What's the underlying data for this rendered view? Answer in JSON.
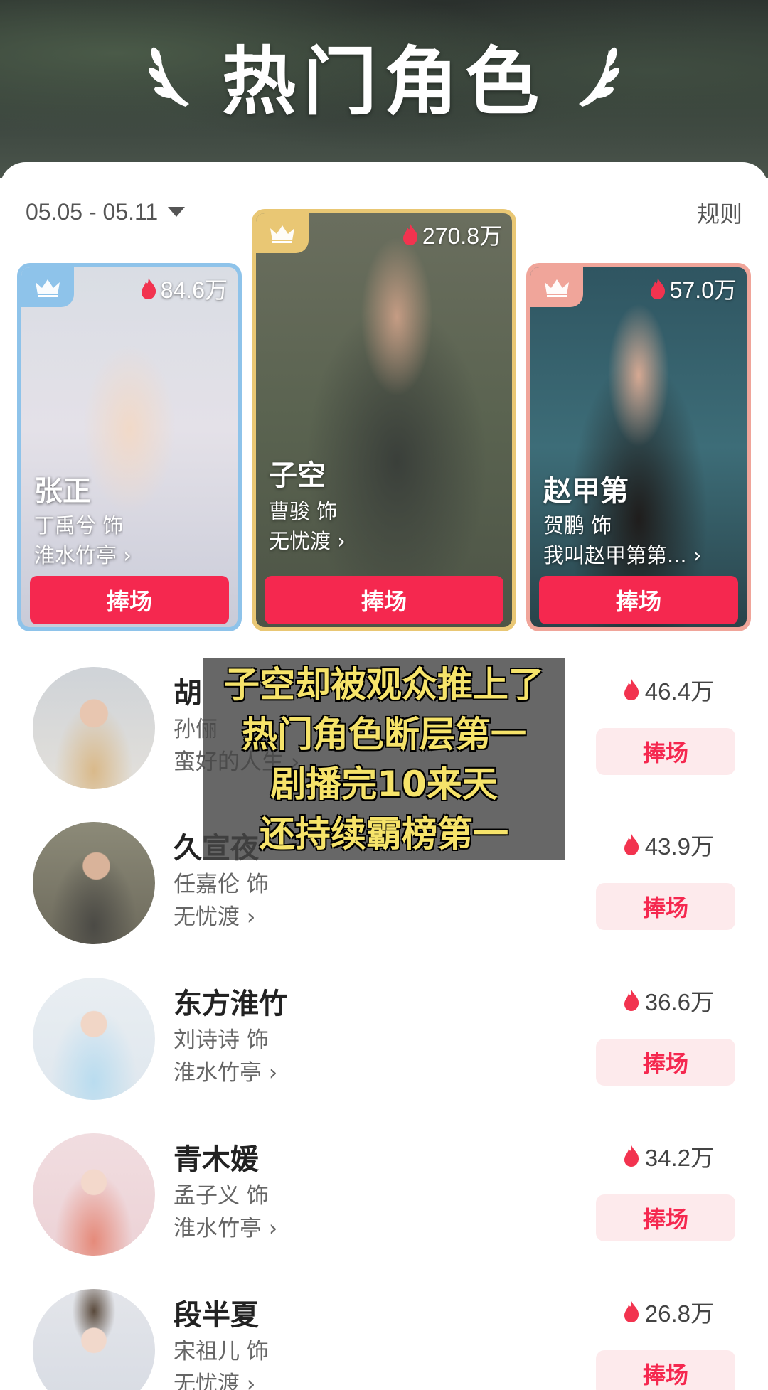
{
  "header": {
    "title": "热门角色"
  },
  "period": {
    "date_range": "05.05 - 05.11",
    "rules_label": "规则"
  },
  "top_cards": [
    {
      "rank": 1,
      "heat": "270.8万",
      "name": "子空",
      "actor": "曹骏 饰",
      "drama": "无忧渡",
      "button": "捧场",
      "frame_color": "#e9c774"
    },
    {
      "rank": 2,
      "heat": "84.6万",
      "name": "张正",
      "actor": "丁禹兮 饰",
      "drama": "淮水竹亭",
      "button": "捧场",
      "frame_color": "#8ec3ea"
    },
    {
      "rank": 3,
      "heat": "57.0万",
      "name": "赵甲第",
      "actor": "贺鹏 饰",
      "drama": "我叫赵甲第第...",
      "button": "捧场",
      "frame_color": "#f0a59a"
    }
  ],
  "ranking": [
    {
      "name": "胡",
      "actor": "孙俪",
      "drama": "蛮好的人生",
      "heat": "46.4万",
      "button": "捧场"
    },
    {
      "name": "久宣夜",
      "actor": "任嘉伦 饰",
      "drama": "无忧渡",
      "heat": "43.9万",
      "button": "捧场"
    },
    {
      "name": "东方淮竹",
      "actor": "刘诗诗 饰",
      "drama": "淮水竹亭",
      "heat": "36.6万",
      "button": "捧场"
    },
    {
      "name": "青木媛",
      "actor": "孟子义 饰",
      "drama": "淮水竹亭",
      "heat": "34.2万",
      "button": "捧场"
    },
    {
      "name": "段半夏",
      "actor": "宋祖儿 饰",
      "drama": "无忧渡",
      "heat": "26.8万",
      "button": "捧场"
    }
  ],
  "caption": {
    "lines": [
      "子空却被观众推上了",
      "热门角色断层第一",
      "剧播完10来天",
      "还持续霸榜第一"
    ],
    "text_color": "#f6e36a"
  },
  "colors": {
    "accent": "#f5284f",
    "soft_button_bg": "#fdeaec",
    "flame": "#f2334f"
  },
  "icons": {
    "crown": "crown-icon",
    "flame": "flame-icon",
    "laurel": "laurel-icon",
    "caret": "caret-down-icon",
    "chevron": "chevron-right-icon"
  }
}
